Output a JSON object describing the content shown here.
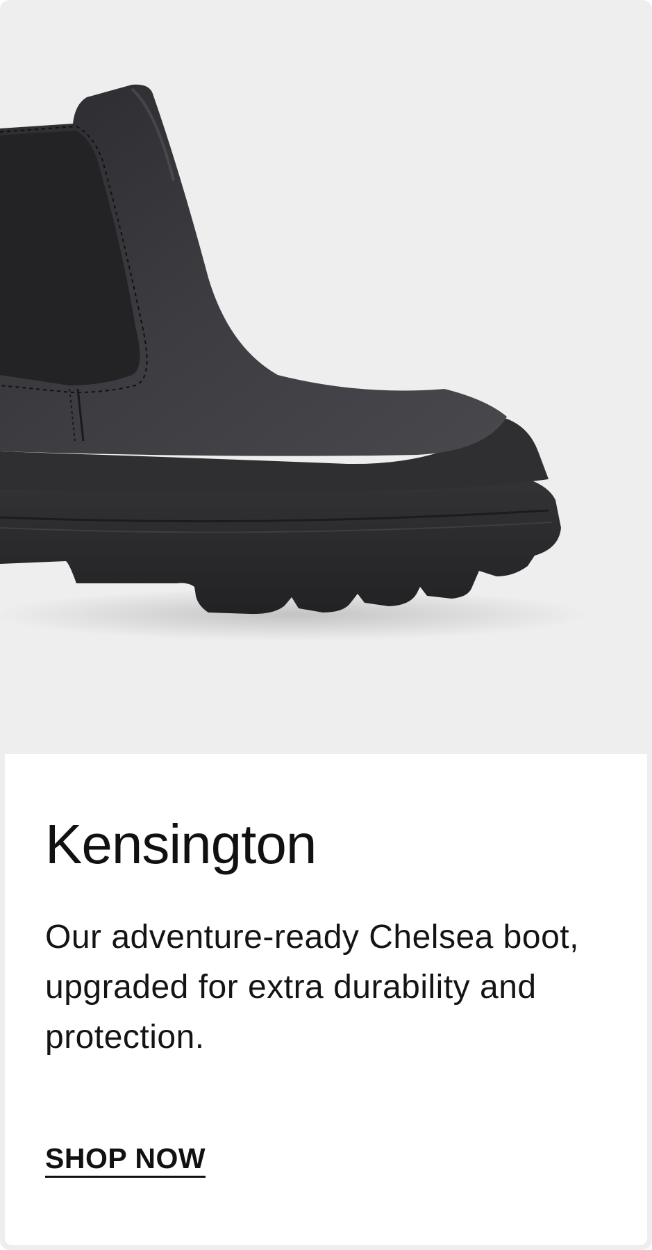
{
  "product": {
    "name": "Kensington",
    "description": "Our adventure-ready Chelsea boot, upgraded for extra durability and protection.",
    "cta_label": "SHOP NOW",
    "image_alt": "black-chelsea-boot"
  },
  "colors": {
    "card_background": "#eeeeee",
    "panel_background": "#ffffff",
    "text": "#111111",
    "boot_upper": "#3a3a3e",
    "boot_sole": "#2a2a2c"
  }
}
